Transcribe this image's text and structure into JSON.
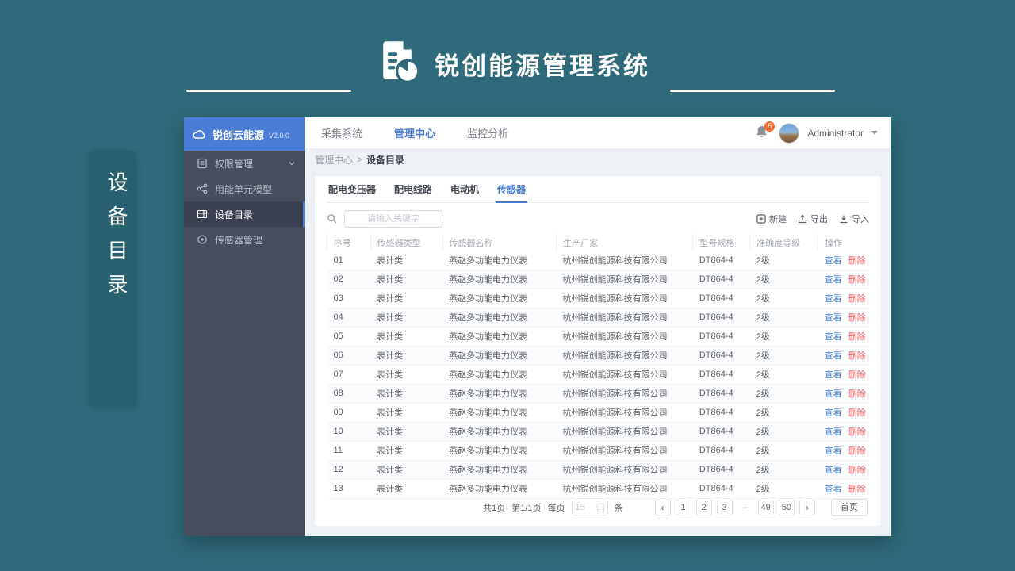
{
  "page": {
    "title": "锐创能源管理系统",
    "side_tag": "设备目录"
  },
  "colors": {
    "page_background": "#2E6A79",
    "accent_blue": "#4A7ED6",
    "danger_red": "#F25B5B",
    "sidebar_bg": "#474E5E",
    "notification_orange": "#F56C2D"
  },
  "icons": {
    "brand_logo": "document-with-pie-chart",
    "sidebar_brand": "cloud",
    "menu": [
      "document-list",
      "share-nodes",
      "grid-table",
      "sensor-disc"
    ],
    "toolbar": [
      "new-plus-square",
      "export-arrow-up",
      "import-arrow-down"
    ],
    "search": "magnifier",
    "notification": "bell"
  },
  "window": {
    "sidebar": {
      "brand": "锐创云能源",
      "version": "V2.0.0",
      "items": [
        {
          "label": "权限管理",
          "active": false,
          "expandable": true
        },
        {
          "label": "用能单元模型",
          "active": false,
          "expandable": false
        },
        {
          "label": "设备目录",
          "active": true,
          "expandable": false
        },
        {
          "label": "传感器管理",
          "active": false,
          "expandable": false
        }
      ]
    },
    "topnav": {
      "items": [
        {
          "label": "采集系统",
          "active": false
        },
        {
          "label": "管理中心",
          "active": true
        },
        {
          "label": "监控分析",
          "active": false
        }
      ],
      "notification_count": "5",
      "username": "Administrator"
    },
    "breadcrumb": {
      "parent": "管理中心",
      "separator": ">",
      "current": "设备目录"
    },
    "tabs": [
      {
        "label": "配电变压器",
        "active": false
      },
      {
        "label": "配电线路",
        "active": false
      },
      {
        "label": "电动机",
        "active": false
      },
      {
        "label": "传感器",
        "active": true
      }
    ],
    "toolbar": {
      "search_placeholder": "请输入关键字",
      "new_label": "新建",
      "export_label": "导出",
      "import_label": "导入"
    },
    "table": {
      "columns": [
        "序号",
        "传感器类型",
        "传感器名称",
        "生产厂家",
        "型号规格",
        "准确度等级",
        "操作"
      ],
      "actions": {
        "view": "查看",
        "delete": "删除"
      },
      "rows": [
        {
          "no": "01",
          "type": "表计类",
          "name": "燕赵多功能电力仪表",
          "manufacturer": "杭州锐创能源科技有限公司",
          "model": "DT864-4",
          "accuracy": "2级"
        },
        {
          "no": "02",
          "type": "表计类",
          "name": "燕赵多功能电力仪表",
          "manufacturer": "杭州锐创能源科技有限公司",
          "model": "DT864-4",
          "accuracy": "2级"
        },
        {
          "no": "03",
          "type": "表计类",
          "name": "燕赵多功能电力仪表",
          "manufacturer": "杭州锐创能源科技有限公司",
          "model": "DT864-4",
          "accuracy": "2级"
        },
        {
          "no": "04",
          "type": "表计类",
          "name": "燕赵多功能电力仪表",
          "manufacturer": "杭州锐创能源科技有限公司",
          "model": "DT864-4",
          "accuracy": "2级"
        },
        {
          "no": "05",
          "type": "表计类",
          "name": "燕赵多功能电力仪表",
          "manufacturer": "杭州锐创能源科技有限公司",
          "model": "DT864-4",
          "accuracy": "2级"
        },
        {
          "no": "06",
          "type": "表计类",
          "name": "燕赵多功能电力仪表",
          "manufacturer": "杭州锐创能源科技有限公司",
          "model": "DT864-4",
          "accuracy": "2级"
        },
        {
          "no": "07",
          "type": "表计类",
          "name": "燕赵多功能电力仪表",
          "manufacturer": "杭州锐创能源科技有限公司",
          "model": "DT864-4",
          "accuracy": "2级"
        },
        {
          "no": "08",
          "type": "表计类",
          "name": "燕赵多功能电力仪表",
          "manufacturer": "杭州锐创能源科技有限公司",
          "model": "DT864-4",
          "accuracy": "2级"
        },
        {
          "no": "09",
          "type": "表计类",
          "name": "燕赵多功能电力仪表",
          "manufacturer": "杭州锐创能源科技有限公司",
          "model": "DT864-4",
          "accuracy": "2级"
        },
        {
          "no": "10",
          "type": "表计类",
          "name": "燕赵多功能电力仪表",
          "manufacturer": "杭州锐创能源科技有限公司",
          "model": "DT864-4",
          "accuracy": "2级"
        },
        {
          "no": "11",
          "type": "表计类",
          "name": "燕赵多功能电力仪表",
          "manufacturer": "杭州锐创能源科技有限公司",
          "model": "DT864-4",
          "accuracy": "2级"
        },
        {
          "no": "12",
          "type": "表计类",
          "name": "燕赵多功能电力仪表",
          "manufacturer": "杭州锐创能源科技有限公司",
          "model": "DT864-4",
          "accuracy": "2级"
        },
        {
          "no": "13",
          "type": "表计类",
          "name": "燕赵多功能电力仪表",
          "manufacturer": "杭州锐创能源科技有限公司",
          "model": "DT864-4",
          "accuracy": "2级"
        }
      ]
    },
    "pagination": {
      "summary_total": "共1页",
      "summary_current": "第1/1页",
      "per_page_label": "每页",
      "per_page_value": "15",
      "unit": "条",
      "prev": "‹",
      "next": "›",
      "pages": [
        "1",
        "2",
        "3",
        "–",
        "49",
        "50"
      ],
      "home": "首页"
    }
  }
}
